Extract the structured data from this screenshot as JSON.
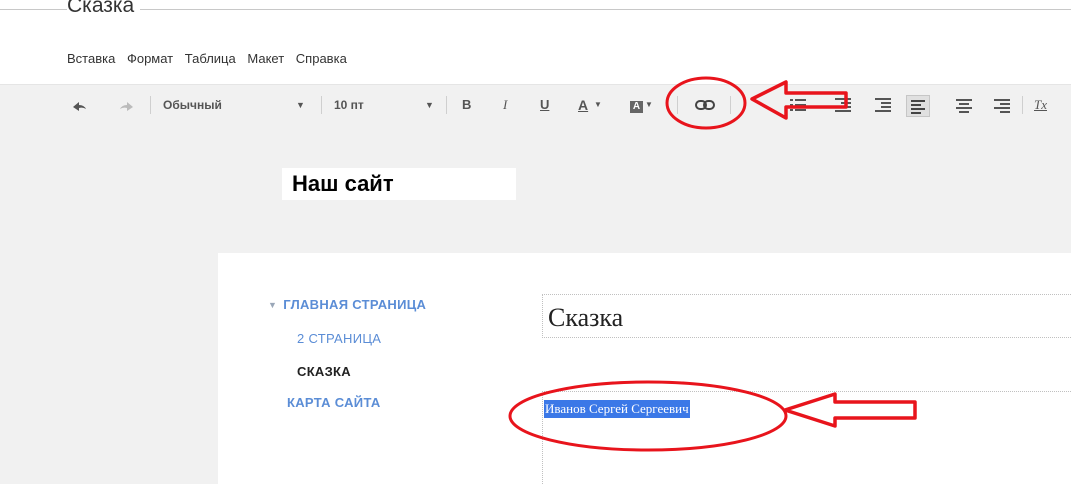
{
  "document": {
    "title": "Сказка"
  },
  "menu": {
    "items": [
      "Вставка",
      "Формат",
      "Таблица",
      "Макет",
      "Справка"
    ]
  },
  "toolbar": {
    "undo_icon": "undo-icon",
    "redo_icon": "redo-icon",
    "style_value": "Обычный",
    "size_value": "10 пт",
    "bold_label": "B",
    "italic_label": "I",
    "underline_label": "U",
    "text_color_label": "A",
    "highlight_label": "A",
    "link_icon": "link-icon",
    "clear_format_label": "Tx"
  },
  "site": {
    "header_text": "Наш сайт"
  },
  "navigation": {
    "items": [
      {
        "label": "ГЛАВНАЯ СТРАНИЦА",
        "expanded": true
      },
      {
        "label": "2 СТРАНИЦА"
      },
      {
        "label": "СКАЗКА",
        "current": true
      },
      {
        "label": "КАРТА САЙТА"
      }
    ]
  },
  "page": {
    "title": "Сказка",
    "selected_text": "Иванов Сергей Сергеевич"
  },
  "colors": {
    "annotation": "#e8141c",
    "link": "#5b8dd6",
    "selection": "#3b78e7",
    "toolbar_bg": "#f1f1f1"
  }
}
